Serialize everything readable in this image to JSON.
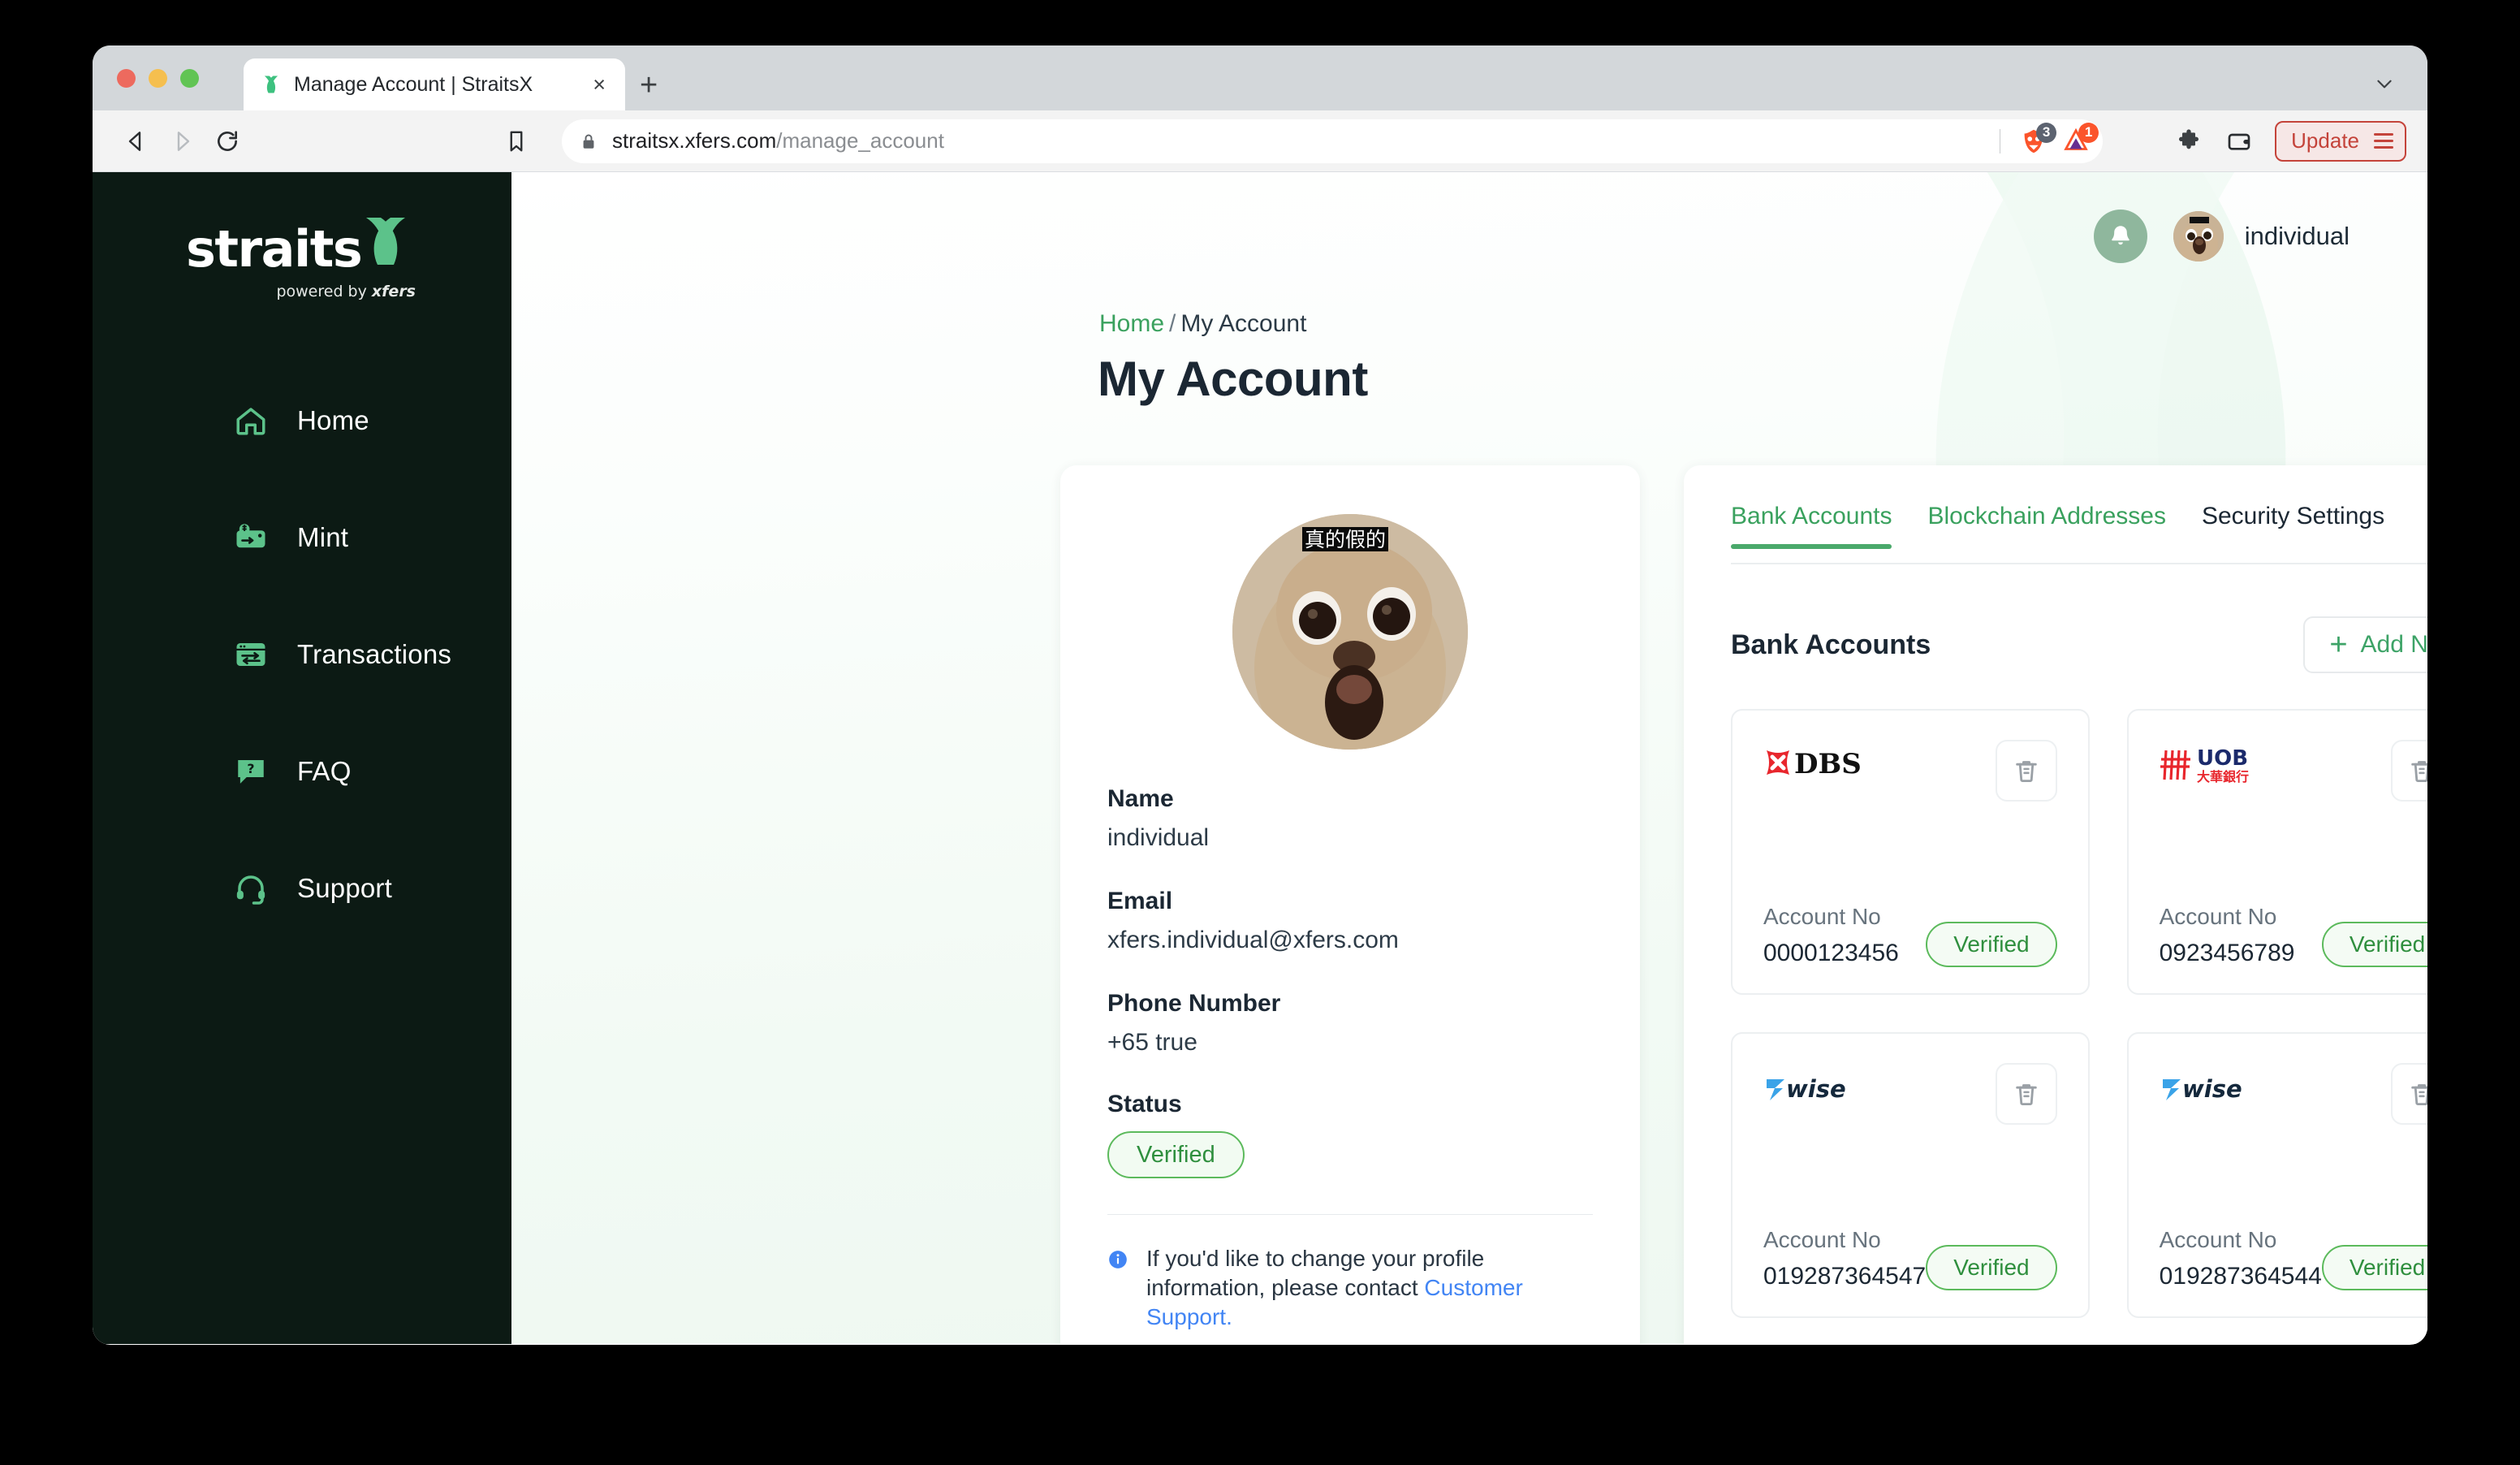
{
  "browser": {
    "tab": {
      "title": "Manage Account | StraitsX",
      "favicon": "straitsx-x-icon",
      "close_label": "×"
    },
    "new_tab_label": "+",
    "url_host": "straitsx.xfers.com",
    "url_path": "/manage_account",
    "shield_badge": "3",
    "rewards_badge": "1",
    "update_label": "Update"
  },
  "sidebar": {
    "logo": {
      "word_a": "straits",
      "word_x": "X",
      "powered": "powered by ",
      "brand": "xfers"
    },
    "items": [
      {
        "label": "Home",
        "icon": "home-icon"
      },
      {
        "label": "Mint",
        "icon": "mint-icon"
      },
      {
        "label": "Transactions",
        "icon": "transactions-icon"
      },
      {
        "label": "FAQ",
        "icon": "faq-icon"
      },
      {
        "label": "Support",
        "icon": "support-headset-icon"
      }
    ]
  },
  "topbar": {
    "bell_icon": "notification-bell-icon",
    "user_name": "individual"
  },
  "breadcrumb": {
    "home": "Home",
    "separator": "/",
    "current": "My Account"
  },
  "page_title": "My Account",
  "profile": {
    "avatar_alt": "chihuahua-meme-avatar",
    "avatar_caption": "真的假的",
    "fields": [
      {
        "label": "Name",
        "value": "individual"
      },
      {
        "label": "Email",
        "value": "xfers.individual@xfers.com"
      },
      {
        "label": "Phone Number",
        "value": "+65 true"
      }
    ],
    "status_label": "Status",
    "status_value": "Verified",
    "note_prefix": "If you'd like to change your profile information, please contact ",
    "note_link": "Customer Support.",
    "note_icon": "info-circle-icon"
  },
  "accounts_panel": {
    "tabs": [
      {
        "label": "Bank Accounts",
        "active": true
      },
      {
        "label": "Blockchain Addresses",
        "active": false
      },
      {
        "label": "Security Settings",
        "active": false
      }
    ],
    "section_title": "Bank Accounts",
    "add_new_label": "Add New",
    "add_new_icon": "plus-icon",
    "delete_icon": "trash-icon",
    "account_label": "Account No",
    "cards": [
      {
        "bank": "DBS",
        "logo": "dbs-logo",
        "account_no": "0000123456",
        "status": "Verified"
      },
      {
        "bank": "UOB",
        "logo": "uob-logo",
        "account_no": "0923456789",
        "status": "Verified"
      },
      {
        "bank": "Wise",
        "logo": "wise-logo",
        "account_no": "019287364547",
        "status": "Verified"
      },
      {
        "bank": "Wise",
        "logo": "wise-logo",
        "account_no": "019287364544",
        "status": "Verified"
      }
    ]
  },
  "colors": {
    "brand_green": "#3aa15e",
    "sidebar_bg": "#0c1a14",
    "accent_green": "#4aa96b",
    "verified_green": "#2f8f3e",
    "link_blue": "#4285f4",
    "update_red": "#c4433a"
  }
}
